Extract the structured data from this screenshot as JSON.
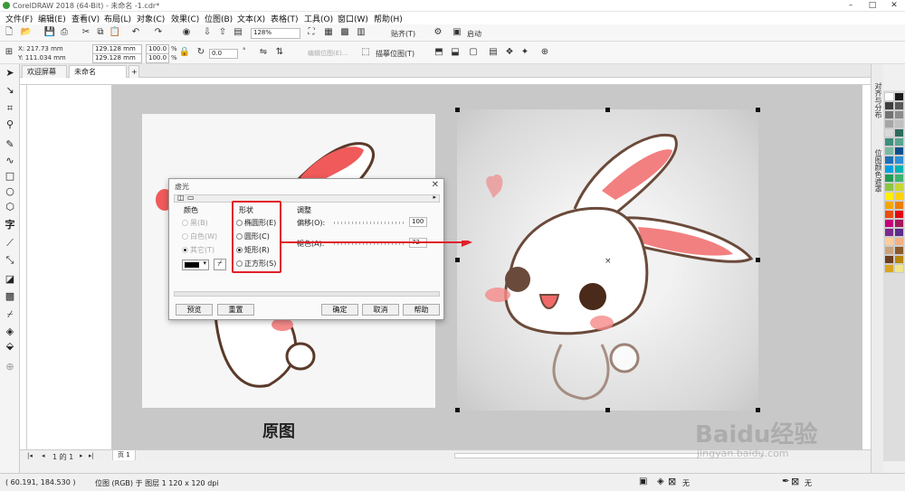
{
  "app": {
    "title": "CorelDRAW 2018 (64-Bit) - 未命名 -1.cdr*"
  },
  "menu": [
    "文件(F)",
    "编辑(E)",
    "查看(V)",
    "布局(L)",
    "对象(C)",
    "效果(C)",
    "位图(B)",
    "文本(X)",
    "表格(T)",
    "工具(O)",
    "窗口(W)",
    "帮助(H)"
  ],
  "toolbar1": {
    "zoom": "128%",
    "snap_label": "贴齐(T)",
    "launch_label": "启动"
  },
  "propbar": {
    "x": "X: 217.73 mm",
    "y": "Y: 111.034 mm",
    "w": "129.128 mm",
    "h": "129.128 mm",
    "sx": "100.0",
    "sy": "100.0",
    "pct": "%",
    "angle": "0.0",
    "deg": "°",
    "edit_bitmap": "编辑位图(E)...",
    "trace_bitmap": "描摹位图(T)"
  },
  "tabs": {
    "welcome": "欢迎屏幕",
    "doc": "未命名 -1.cdr*",
    "add": "+"
  },
  "dialog": {
    "title": "虚光",
    "color_group": "颜色",
    "color_opts": [
      "黑(B)",
      "白色(W)",
      "其它(T)"
    ],
    "shape_group": "形状",
    "shape_opts": [
      "椭圆形(E)",
      "圆形(C)",
      "矩形(R)",
      "正方形(S)"
    ],
    "adjust_group": "调整",
    "offset_label": "偏移(O):",
    "offset_value": "100",
    "fade_label": "褪色(A):",
    "fade_value": "72",
    "preview": "预览",
    "reset": "重置",
    "ok": "确定",
    "cancel": "取消",
    "help": "帮助"
  },
  "canvas": {
    "caption": "原图"
  },
  "pagenav": {
    "page_of": "1 的 1",
    "page_tab": "页 1"
  },
  "status": {
    "coords": "( 60.191, 184.530 )",
    "info": "位图 (RGB) 于 图层 1 120 x 120 dpi",
    "fill": "无",
    "outline": "无"
  },
  "docker": {
    "tab1": "对齐与分布",
    "tab2": "位图颜色遮罩"
  },
  "watermark": {
    "brand": "Baidu经验",
    "url": "jingyan.baidu.com"
  },
  "colors": {
    "highlight": "#e0202a",
    "swatches": [
      "#ffffff",
      "#1a1a1a",
      "#3d3d3d",
      "#595959",
      "#737373",
      "#8c8c8c",
      "#a6a6a6",
      "#c0c0c0",
      "#d9d9d9",
      "#2e6b5e",
      "#3e8e7e",
      "#5aa58f",
      "#7bbaa5",
      "#0a4f8a",
      "#1d6fb8",
      "#2d8fd8",
      "#00a0e0",
      "#00b4b4",
      "#1f9d55",
      "#3cb371",
      "#8dc63f",
      "#c6d82e",
      "#ffef00",
      "#ffd200",
      "#f7a600",
      "#ef7d00",
      "#e84e0f",
      "#e30613",
      "#c4007a",
      "#a3195b",
      "#7b2a8c",
      "#5b2d8c",
      "#ffcc99",
      "#f4b183",
      "#c9a27c",
      "#8b5a2b",
      "#6b3e1e",
      "#b8860b",
      "#daa520",
      "#f0e68c"
    ]
  }
}
